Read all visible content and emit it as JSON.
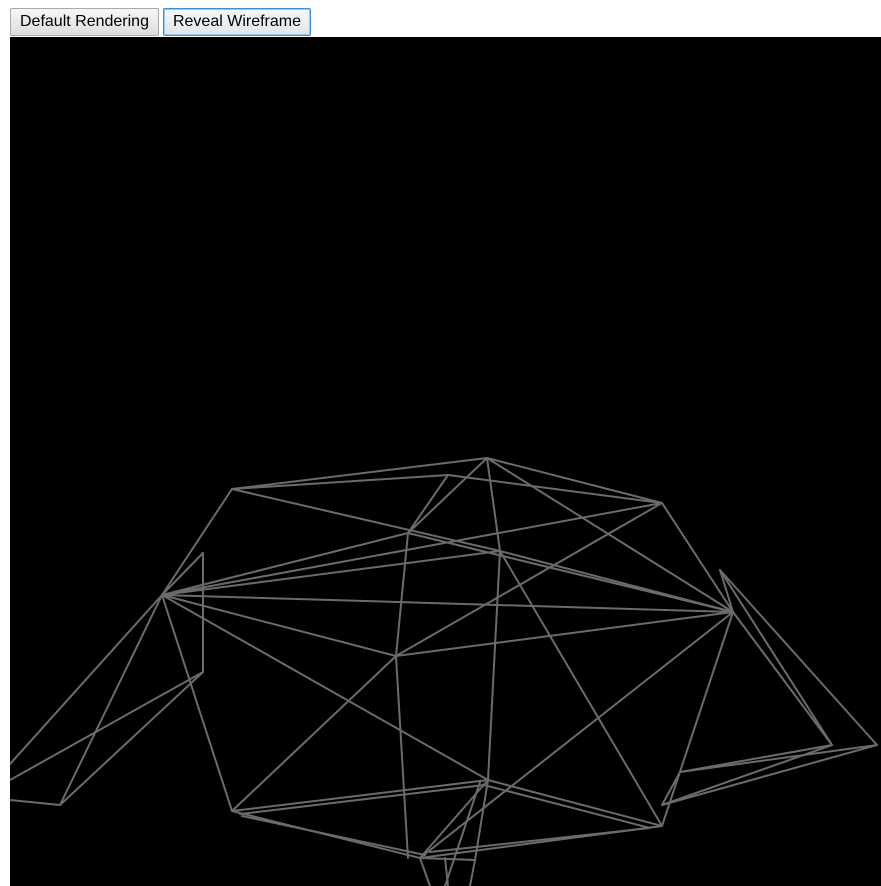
{
  "toolbar": {
    "default_label": "Default Rendering",
    "wireframe_label": "Reveal Wireframe"
  },
  "viewport": {
    "background": "#000000",
    "wire_color": "#6b6b6b",
    "mode": "wireframe"
  }
}
